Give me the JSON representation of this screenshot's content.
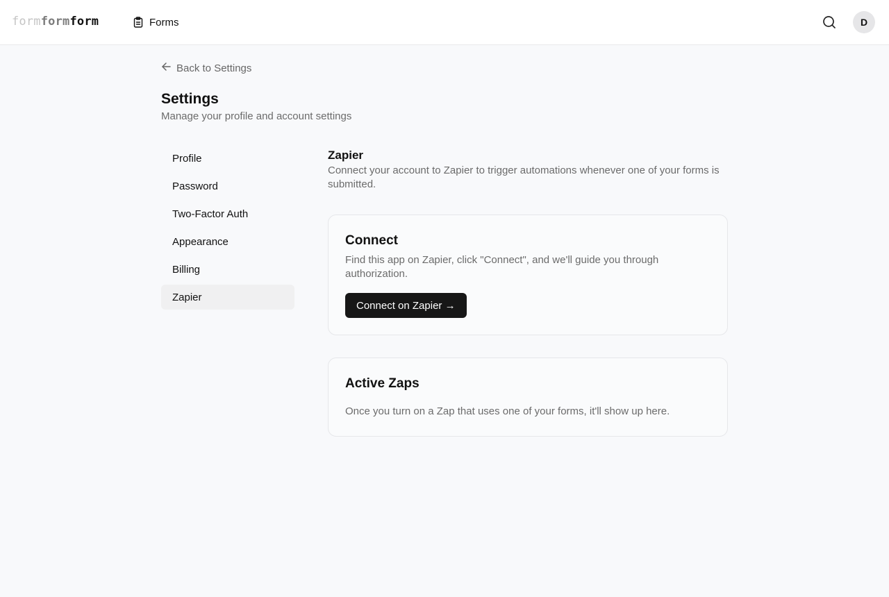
{
  "header": {
    "logo_parts": [
      "form",
      "form",
      "form"
    ],
    "nav_forms_label": "Forms",
    "avatar_initial": "D"
  },
  "page": {
    "back_label": "Back to Settings",
    "title": "Settings",
    "subtitle": "Manage your profile and account settings"
  },
  "sidebar": {
    "items": [
      {
        "label": "Profile",
        "active": false
      },
      {
        "label": "Password",
        "active": false
      },
      {
        "label": "Two-Factor Auth",
        "active": false
      },
      {
        "label": "Appearance",
        "active": false
      },
      {
        "label": "Billing",
        "active": false
      },
      {
        "label": "Zapier",
        "active": true
      }
    ]
  },
  "section": {
    "title": "Zapier",
    "description": "Connect your account to Zapier to trigger automations whenever one of your forms is submitted."
  },
  "connect_card": {
    "title": "Connect",
    "description": "Find this app on Zapier, click \"Connect\", and we'll guide you through authorization.",
    "button_label": "Connect on Zapier →"
  },
  "zaps_card": {
    "title": "Active Zaps",
    "description": "Once you turn on a Zap that uses one of your forms, it'll show up here."
  },
  "icons": {
    "forms": "clipboard-icon",
    "search": "search-icon",
    "back": "arrow-left-icon"
  },
  "colors": {
    "primary_button": "#171717",
    "active_nav_bg": "#f0f0f1",
    "page_bg": "#f8f9fb"
  }
}
